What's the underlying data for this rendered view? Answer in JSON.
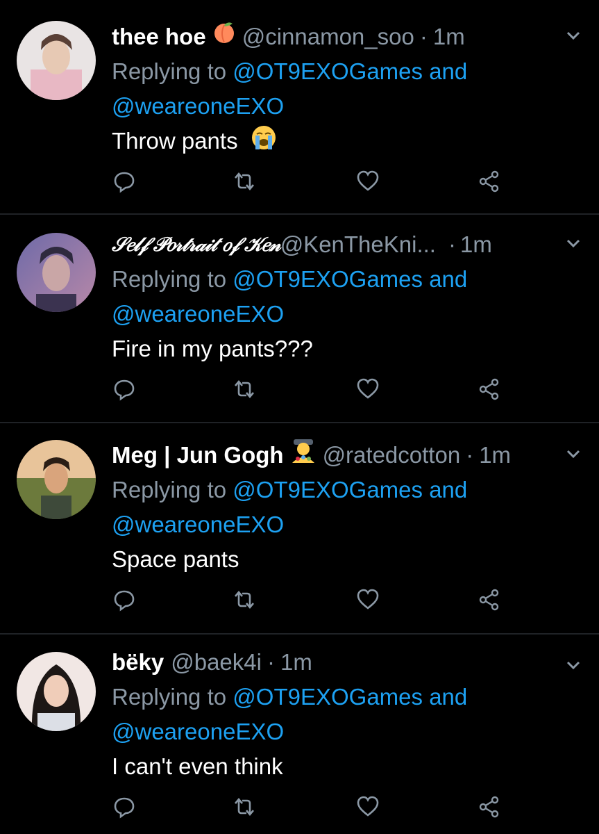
{
  "tweets": [
    {
      "name": "thee hoe",
      "name_emoji": "peach-emoji",
      "handle": "@cinnamon_soo",
      "dot": "·",
      "time": "1m",
      "replying_prefix": "Replying to",
      "reply_to_1": "@OT9EXOGames",
      "reply_and": "and",
      "reply_to_2": "@weareoneEXO",
      "text": "Throw pants",
      "text_emoji": "loudly-crying-emoji"
    },
    {
      "name": "𝒮𝑒𝓁𝒻 𝒫𝑜𝓇𝓉𝓇𝒶𝒾𝓉 𝑜𝒻 𝒦𝑒𝓃",
      "handle": "@KenTheKni...",
      "dot": "·",
      "time": "1m",
      "replying_prefix": "Replying to",
      "reply_to_1": "@OT9EXOGames",
      "reply_and": "and",
      "reply_to_2": "@weareoneEXO",
      "text": "Fire in my pants???"
    },
    {
      "name": "Meg | Jun Gogh",
      "name_emoji": "artist-emoji",
      "handle": "@ratedcotton",
      "dot": "·",
      "time": "1m",
      "replying_prefix": "Replying to",
      "reply_to_1": "@OT9EXOGames",
      "reply_and": "and",
      "reply_to_2": "@weareoneEXO",
      "text": "Space pants"
    },
    {
      "name": "bëky",
      "handle": "@baek4i",
      "dot": "·",
      "time": "1m",
      "replying_prefix": "Replying to",
      "reply_to_1": "@OT9EXOGames",
      "reply_and": "and",
      "reply_to_2": "@weareoneEXO",
      "text": "I can't even think"
    }
  ],
  "colors": {
    "background": "#000000",
    "secondary_text": "#8b98a5",
    "link": "#1da1f2",
    "separator": "#1f2226"
  },
  "icons": [
    "reply-icon",
    "retweet-icon",
    "like-icon",
    "share-icon",
    "chevron-down-icon"
  ]
}
